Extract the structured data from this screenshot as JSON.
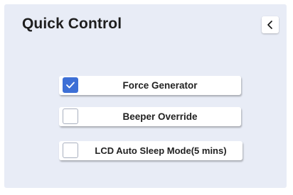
{
  "header": {
    "title": "Quick Control",
    "back_icon": "chevron-left-icon"
  },
  "options": [
    {
      "label": "Force Generator",
      "checked": true
    },
    {
      "label": "Beeper Override",
      "checked": false
    },
    {
      "label": "LCD Auto Sleep Mode(5 mins)",
      "checked": false
    }
  ],
  "colors": {
    "panel_background": "#e8ecf6",
    "checkbox_checked": "#3d6fd6"
  }
}
